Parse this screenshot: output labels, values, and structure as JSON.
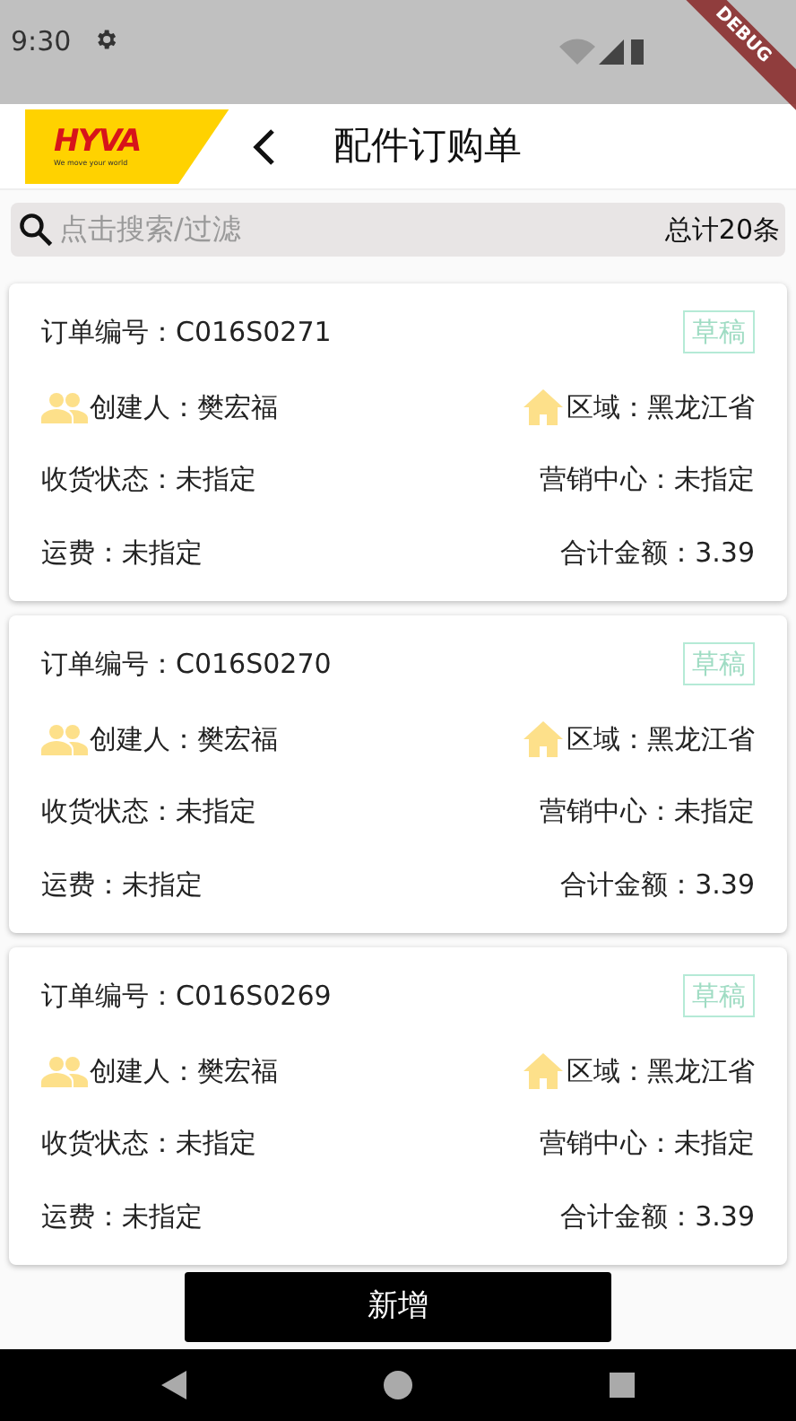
{
  "status_bar": {
    "time": "9:30"
  },
  "debug_banner": {
    "label": "DEBUG"
  },
  "header": {
    "logo_text": "HYVA",
    "logo_slogan": "We move your world",
    "title": "配件订购单"
  },
  "search": {
    "placeholder": "点击搜索/过滤",
    "total": "总计20条"
  },
  "orders": [
    {
      "number": "订单编号：C016S0271",
      "status": "草稿",
      "creator": "创建人：樊宏福",
      "region": "区域：黑龙江省",
      "receipt_status": "收货状态：未指定",
      "sales_center": "营销中心：未指定",
      "freight": "运费：未指定",
      "total": "合计金额：3.39"
    },
    {
      "number": "订单编号：C016S0270",
      "status": "草稿",
      "creator": "创建人：樊宏福",
      "region": "区域：黑龙江省",
      "receipt_status": "收货状态：未指定",
      "sales_center": "营销中心：未指定",
      "freight": "运费：未指定",
      "total": "合计金额：3.39"
    },
    {
      "number": "订单编号：C016S0269",
      "status": "草稿",
      "creator": "创建人：樊宏福",
      "region": "区域：黑龙江省",
      "receipt_status": "收货状态：未指定",
      "sales_center": "营销中心：未指定",
      "freight": "运费：未指定",
      "total": "合计金额：3.39"
    }
  ],
  "add_button": "新增"
}
